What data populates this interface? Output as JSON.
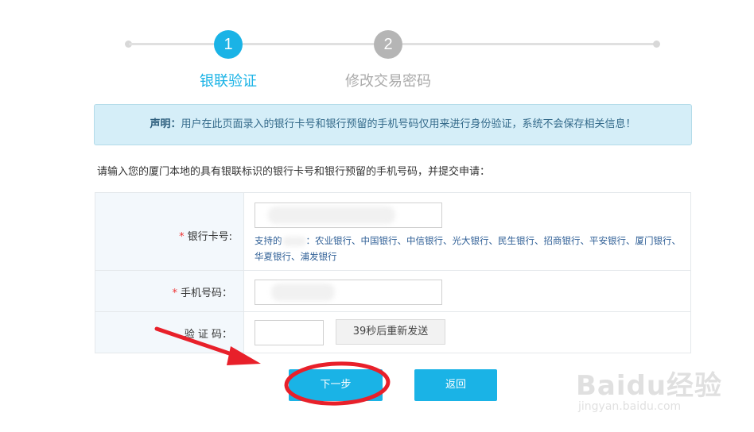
{
  "stepper": {
    "steps": [
      {
        "number": "1",
        "label": "银联验证",
        "state": "active"
      },
      {
        "number": "2",
        "label": "修改交易密码",
        "state": "inactive"
      }
    ]
  },
  "notice": {
    "title": "声明：",
    "text": "用户在此页面录入的银行卡号和银行预留的手机号码仅用来进行身份验证，系统不会保存相关信息！"
  },
  "instruction": "请输入您的厦门本地的具有银联标识的银行卡号和银行预留的手机号码，并提交申请：",
  "form": {
    "card": {
      "required_mark": "*",
      "label": "银行卡号:",
      "supported_prefix": "支持的",
      "supported_banks": "：农业银行、中国银行、中信银行、光大银行、民生银行、招商银行、平安银行、厦门银行、华夏银行、浦发银行"
    },
    "phone": {
      "required_mark": "*",
      "label": "手机号码："
    },
    "code": {
      "label": "验 证 码：",
      "resend_label": "39秒后重新发送"
    }
  },
  "actions": {
    "next_label": "下一步",
    "back_label": "返回"
  },
  "watermark": {
    "main": "Baidu经验",
    "sub": "jingyan.baidu.com"
  },
  "colors": {
    "accent": "#1ab3e6",
    "inactive_step": "#b5b5b5",
    "notice_bg": "#d5eef8",
    "annotation": "#e8202a"
  }
}
